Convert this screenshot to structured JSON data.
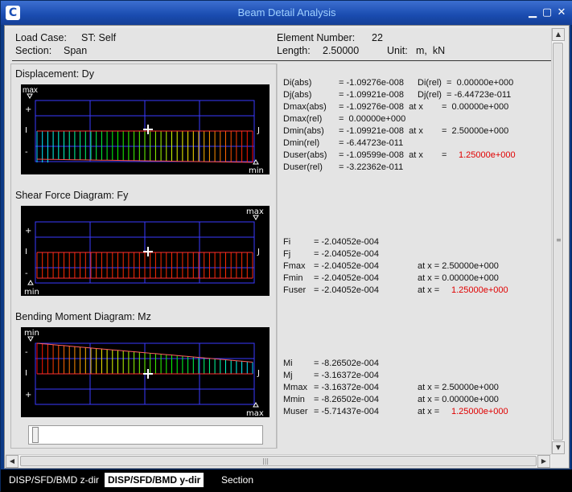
{
  "window": {
    "title": "Beam Detail Analysis"
  },
  "header": {
    "load_case_label": "Load Case:",
    "load_case_value": "ST: Self",
    "section_label": "Section:",
    "section_value": "Span",
    "element_label": "Element Number:",
    "element_value": "22",
    "length_label": "Length:",
    "length_value": "2.50000",
    "unit_label": "Unit:",
    "unit_value": "m,  kN"
  },
  "plots": {
    "disp_title": "Displacement: Dy",
    "shear_title": "Shear Force Diagram: Fy",
    "moment_title": "Bending Moment Diagram: Mz",
    "label_max": "max",
    "label_min": "min",
    "label_plus": "+",
    "label_minus": "-",
    "label_i": "I",
    "label_j": "J"
  },
  "displacement": {
    "rows": [
      [
        "Di(abs)",
        "= -1.09276e-008",
        "Di(rel)  =  0.00000e+000"
      ],
      [
        "Dj(abs)",
        "= -1.09921e-008",
        "Dj(rel)  = -6.44723e-011"
      ],
      [
        "Dmax(abs)",
        "= -1.09276e-008  at x",
        "=  0.00000e+000"
      ],
      [
        "Dmax(rel)",
        "=  0.00000e+000",
        ""
      ],
      [
        "Dmin(abs)",
        "= -1.09921e-008  at x",
        "=  2.50000e+000"
      ],
      [
        "Dmin(rel)",
        "= -6.44723e-011",
        ""
      ],
      [
        "Duser(abs)",
        "= -1.09599e-008  at x",
        ""
      ],
      [
        "Duser(rel)",
        "= -3.22362e-011",
        ""
      ]
    ],
    "duser_x": "1.25000e+000"
  },
  "shear": {
    "fi_label": "Fi",
    "fi_value": "= -2.04052e-004",
    "fj_label": "Fj",
    "fj_value": "= -2.04052e-004",
    "fmax_label": "Fmax",
    "fmax_value": "= -2.04052e-004",
    "fmax_at": "at x = 2.50000e+000",
    "fmin_label": "Fmin",
    "fmin_value": "= -2.04052e-004",
    "fmin_at": "at x = 0.00000e+000",
    "fuser_label": "Fuser",
    "fuser_value": "= -2.04052e-004",
    "fuser_at_label": "at x = ",
    "fuser_x": "1.25000e+000"
  },
  "moment": {
    "mi_label": "Mi",
    "mi_value": "= -8.26502e-004",
    "mj_label": "Mj",
    "mj_value": "= -3.16372e-004",
    "mmax_label": "Mmax",
    "mmax_value": "= -3.16372e-004",
    "mmax_at": "at x = 2.50000e+000",
    "mmin_label": "Mmin",
    "mmin_value": "= -8.26502e-004",
    "mmin_at": "at x = 0.00000e+000",
    "muser_label": "Muser",
    "muser_value": "= -5.71437e-004",
    "muser_at_label": "at x = ",
    "muser_x": "1.25000e+000"
  },
  "tabs": [
    "DISP/SFD/BMD z-dir",
    "DISP/SFD/BMD y-dir",
    "Section"
  ],
  "colors": {
    "accent_red": "#e00000",
    "plot_bg": "#000000",
    "grid": "#3a3aff"
  }
}
